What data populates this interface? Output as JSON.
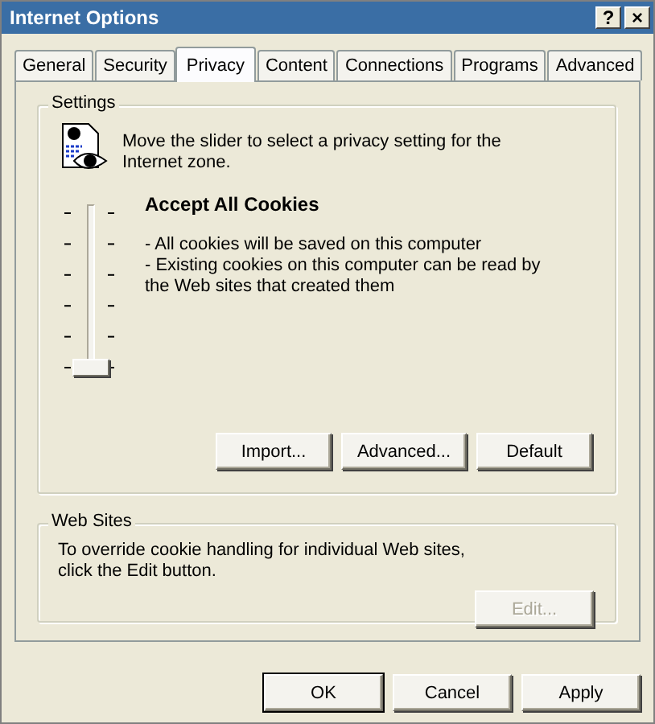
{
  "window": {
    "title": "Internet Options",
    "title_buttons": [
      "?",
      "×"
    ]
  },
  "tabs": [
    {
      "label": "General",
      "selected": false
    },
    {
      "label": "Security",
      "selected": false
    },
    {
      "label": "Privacy",
      "selected": true
    },
    {
      "label": "Content",
      "selected": false
    },
    {
      "label": "Connections",
      "selected": false
    },
    {
      "label": "Programs",
      "selected": false
    },
    {
      "label": "Advanced",
      "selected": false
    }
  ],
  "settings": {
    "legend": "Settings",
    "intro": "Move the slider to select a privacy setting for the Internet zone.",
    "slider": {
      "level": 0
    },
    "level_title": "Accept All Cookies",
    "level_description": [
      "- All cookies will be saved on this computer",
      "- Existing cookies on this computer can be read by the Web sites that created them"
    ],
    "buttons": [
      {
        "label": "Import...",
        "disabled": false
      },
      {
        "label": "Advanced...",
        "disabled": false
      },
      {
        "label": "Default",
        "disabled": false
      }
    ]
  },
  "web_sites": {
    "legend": "Web Sites",
    "text": "To override cookie handling for individual Web sites, click the Edit button.",
    "buttons": [
      {
        "label": "Edit...",
        "disabled": true
      }
    ]
  },
  "dialog_buttons": [
    {
      "label": "OK",
      "default": true
    },
    {
      "label": "Cancel",
      "default": false
    },
    {
      "label": "Apply",
      "default": false
    }
  ]
}
